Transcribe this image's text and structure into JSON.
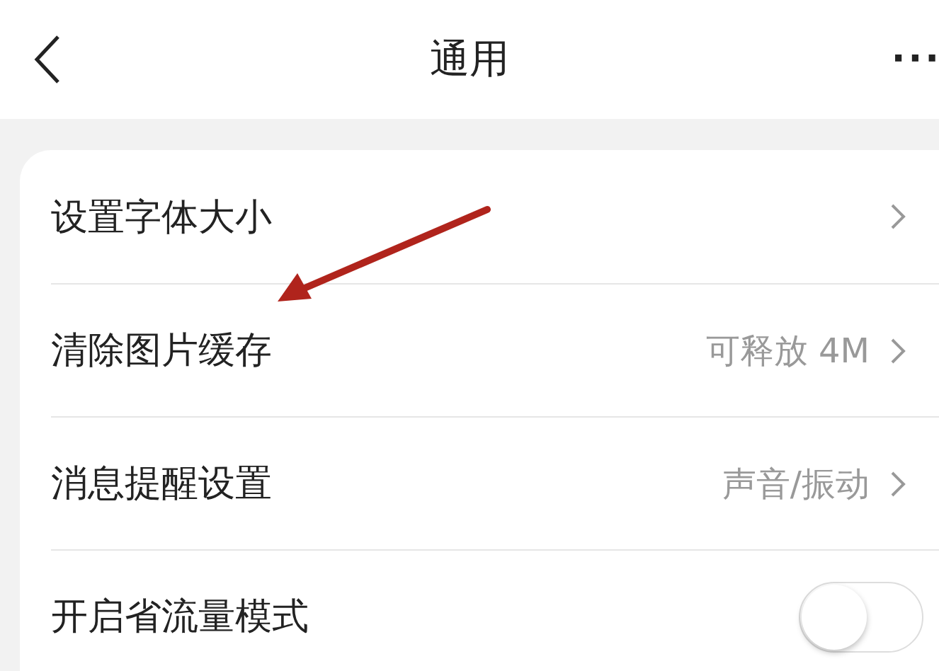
{
  "header": {
    "title": "通用",
    "more": "···"
  },
  "annotations": [
    {
      "kind": "arrow"
    }
  ],
  "settings": [
    {
      "kind": "link",
      "label": "设置字体大小"
    },
    {
      "kind": "link",
      "label": "清除图片缓存",
      "value": "可释放 4M"
    },
    {
      "kind": "link",
      "label": "消息提醒设置",
      "value": "声音/振动"
    },
    {
      "kind": "toggle",
      "label": "开启省流量模式",
      "on": false
    }
  ]
}
